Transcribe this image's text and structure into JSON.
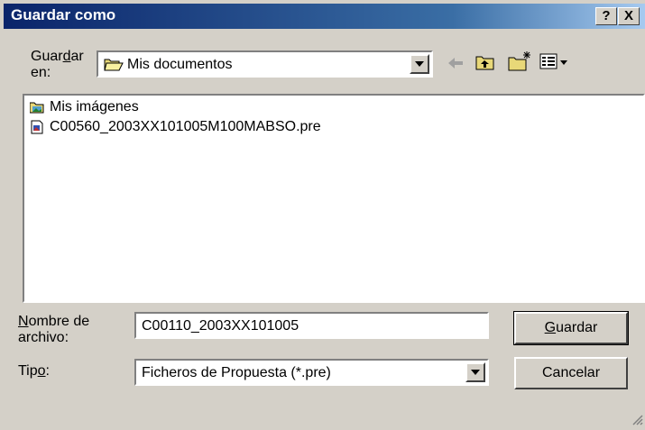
{
  "window": {
    "title": "Guardar como",
    "help_label": "?",
    "close_label": "X"
  },
  "save_in": {
    "label_pre": "Guar",
    "label_accel": "d",
    "label_post": "ar",
    "label_line2": "en:",
    "value": "Mis documentos",
    "icon": "folder-open-icon"
  },
  "toolbar": {
    "back_icon": "back-arrow-icon",
    "up_icon": "up-one-level-icon",
    "new_folder_icon": "new-folder-icon",
    "view_menu_icon": "view-menu-icon"
  },
  "files": [
    {
      "name": "Mis imágenes",
      "icon": "picture-folder-icon"
    },
    {
      "name": "C00560_2003XX101005M100MABSO.pre",
      "icon": "document-icon"
    }
  ],
  "filename": {
    "label_accel": "N",
    "label_rest": "ombre de",
    "label_line2": "archivo:",
    "value": "C00110_2003XX101005"
  },
  "filetype": {
    "label_pre": "Tip",
    "label_accel": "o",
    "label_post": ":",
    "value": "Ficheros de Propuesta (*.pre)"
  },
  "buttons": {
    "save_accel": "G",
    "save_rest": "uardar",
    "cancel": "Cancelar"
  }
}
